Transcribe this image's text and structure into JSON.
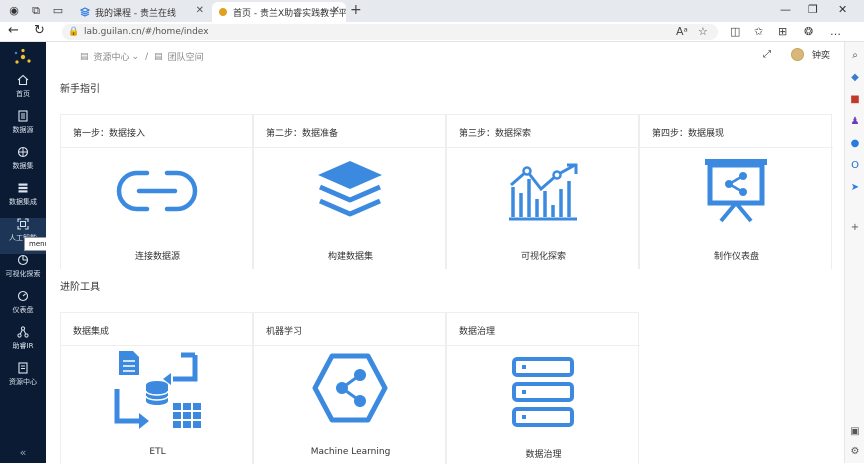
{
  "browser": {
    "tabs": [
      {
        "title": "我的课程 - 贵兰在线"
      },
      {
        "title": "首页 - 贵兰X助睿实践教学平台"
      }
    ],
    "url": "lab.guilan.cn/#/home/index"
  },
  "header": {
    "breadcrumb": [
      "资源中心",
      "团队空间"
    ],
    "user_name": "钟奕"
  },
  "sidebar": {
    "items": [
      {
        "label": "首页",
        "icon": "home-icon"
      },
      {
        "label": "数据源",
        "icon": "datasource-icon"
      },
      {
        "label": "数据集",
        "icon": "dataset-icon"
      },
      {
        "label": "数据集成",
        "icon": "integration-icon"
      },
      {
        "label": "人工智能",
        "icon": "ai-icon"
      },
      {
        "label": "可视化探索",
        "icon": "visual-icon"
      },
      {
        "label": "仪表盘",
        "icon": "dashboard-icon"
      },
      {
        "label": "助睿IR",
        "icon": "graph-icon"
      },
      {
        "label": "资源中心",
        "icon": "resource-icon"
      }
    ],
    "tooltip": "menuTitle.人工智能"
  },
  "guide": {
    "title": "新手指引",
    "steps": [
      {
        "title": "第一步：数据接入",
        "label": "连接数据源"
      },
      {
        "title": "第二步：数据准备",
        "label": "构建数据集"
      },
      {
        "title": "第三步：数据探索",
        "label": "可视化探索"
      },
      {
        "title": "第四步：数据展现",
        "label": "制作仪表盘"
      }
    ]
  },
  "tools": {
    "title": "进阶工具",
    "items": [
      {
        "title": "数据集成",
        "label": "ETL"
      },
      {
        "title": "机器学习",
        "label": "Machine Learning"
      },
      {
        "title": "数据治理",
        "label": "数据治理"
      }
    ]
  },
  "colors": {
    "accent": "#3b8ae0",
    "sidebar": "#0b1b33"
  }
}
